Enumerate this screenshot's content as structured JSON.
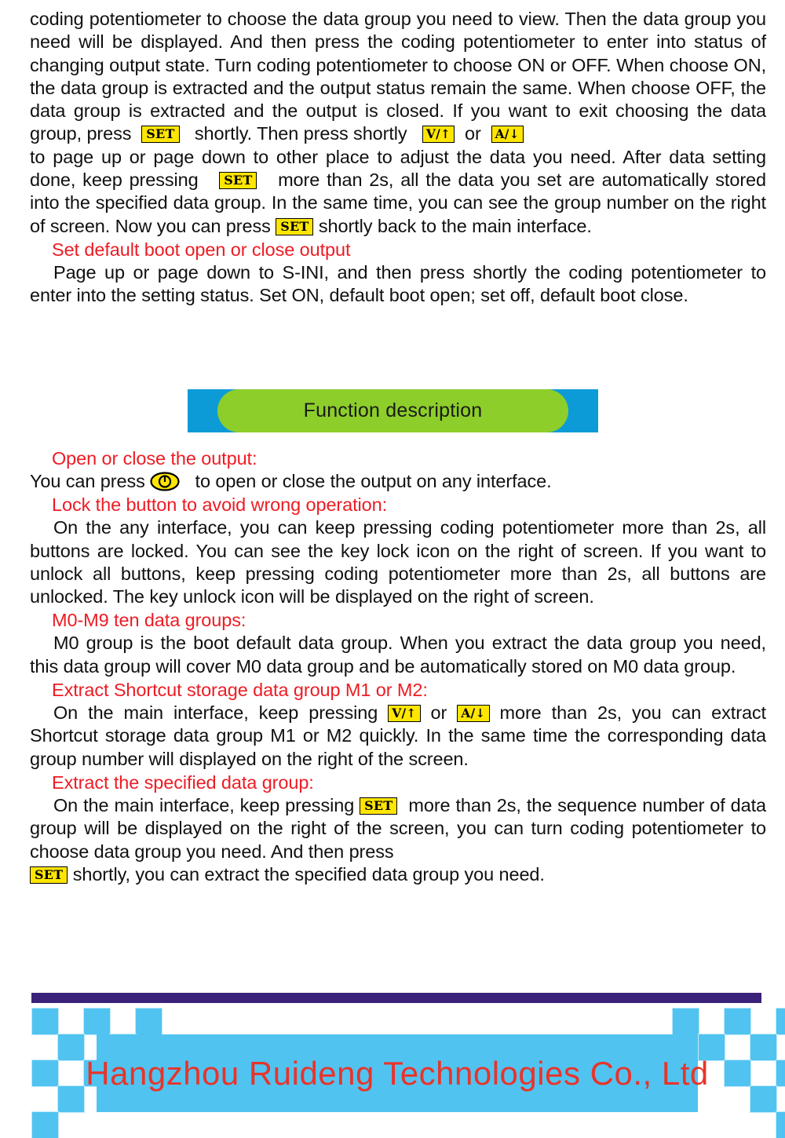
{
  "document": {
    "paragraphs": {
      "p1_part1": "coding potentiometer to choose the data group you need to view. Then the data group you need will be displayed. And then press the coding potentiometer to enter into status of changing output state. Turn coding potentiometer to choose ON or OFF. When choose ON, the data group is extracted and the output status remain the same. When choose OFF, the data group is extracted and the output is closed. If you want to exit choosing the data group, press",
      "p1_part2": "shortly. Then press shortly",
      "p1_part3": "or",
      "p1_part4": "to page up or page down to other place to adjust the data you need. After data setting done, keep pressing",
      "p1_part5": "more than 2s, all the data you set are automatically stored into the specified data group. In the same time, you can see the group number on the right of screen. Now you can press",
      "p1_part6": "shortly back to the main interface."
    },
    "section_boot": {
      "heading": "Set default boot open or close output",
      "body": "Page up or page down to S-INI, and then press shortly the coding potentiometer to enter into the setting status. Set ON, default boot open; set off, default boot close."
    },
    "banner": {
      "label": "Function description",
      "blue_color": "#0c9bd7",
      "green_color": "#8dce2a"
    },
    "section_output": {
      "heading": "Open or close the output:",
      "body_before": "You can press",
      "body_after": "to open or close the output on any interface.",
      "icon": "power-button-icon"
    },
    "section_lock": {
      "heading": "Lock the button to avoid wrong operation:",
      "body": "On the any interface, you can keep pressing coding potentiometer more than 2s, all buttons are locked. You can see the key lock icon on the right of screen. If you want to unlock all buttons, keep pressing coding potentiometer more than 2s, all buttons are unlocked. The key unlock icon will be displayed on the right of screen."
    },
    "section_groups": {
      "heading": "M0-M9 ten data groups:",
      "body": "M0 group is the boot default data group. When you extract the data group you need, this data group will cover M0 data group and be automatically stored on M0 data group."
    },
    "section_shortcut": {
      "heading": "Extract Shortcut storage data group M1 or M2:",
      "body_before": "On the main interface, keep pressing",
      "body_mid": "or",
      "body_after": "more than 2s, you can extract Shortcut storage data group M1 or M2 quickly. In the same time the corresponding data group number will displayed on the right of the screen."
    },
    "section_specified": {
      "heading": "Extract the specified data group:",
      "body_before": "On the main interface, keep pressing",
      "body_mid": "more than 2s, the sequence number of data group will be displayed on the right of the screen, you can turn coding potentiometer to choose data group you need. And then press",
      "body_after": "shortly, you can extract the specified data group you need."
    },
    "keys": {
      "set": "SET",
      "volt_up": "V/↑",
      "amp_down": "A/↓"
    },
    "footer": {
      "company": "Hangzhou Ruideng Technologies Co., Ltd",
      "bar_color": "#3a2179",
      "check_color": "#51c3f0",
      "text_color": "#e8342a"
    }
  }
}
